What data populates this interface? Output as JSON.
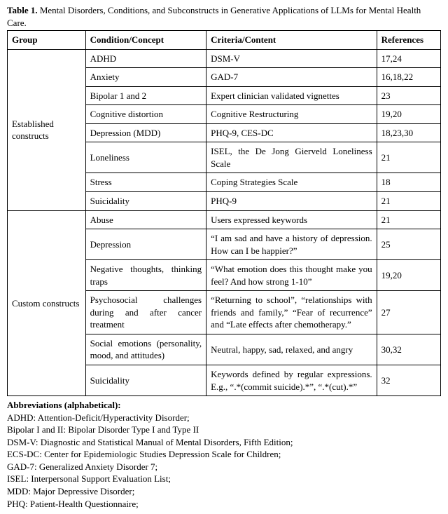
{
  "caption_prefix": "Table 1.",
  "caption_text": "Mental Disorders, Conditions, and Subconstructs in Generative Applications of LLMs for Mental Health Care.",
  "headers": {
    "group": "Group",
    "condition": "Condition/Concept",
    "criteria": "Criteria/Content",
    "refs": "References"
  },
  "groups": [
    {
      "label": "Established constructs",
      "rows": [
        {
          "condition": "ADHD",
          "criteria": "DSM-V",
          "refs": "17,24"
        },
        {
          "condition": "Anxiety",
          "criteria": "GAD-7",
          "refs": "16,18,22"
        },
        {
          "condition": "Bipolar 1 and 2",
          "criteria": "Expert clinician validated vignettes",
          "refs": "23"
        },
        {
          "condition": "Cognitive distortion",
          "criteria": "Cognitive Restructuring",
          "refs": "19,20"
        },
        {
          "condition": "Depression (MDD)",
          "criteria": "PHQ-9, CES-DC",
          "refs": "18,23,30"
        },
        {
          "condition": "Loneliness",
          "criteria": "ISEL, the De Jong Gierveld Loneliness Scale",
          "refs": "21"
        },
        {
          "condition": "Stress",
          "criteria": "Coping Strategies Scale",
          "refs": "18"
        },
        {
          "condition": "Suicidality",
          "criteria": "PHQ-9",
          "refs": "21"
        }
      ]
    },
    {
      "label": "Custom constructs",
      "rows": [
        {
          "condition": "Abuse",
          "criteria": "Users expressed keywords",
          "refs": "21"
        },
        {
          "condition": "Depression",
          "criteria": "“I am sad and have a history of depression. How can I be happier?”",
          "refs": "25"
        },
        {
          "condition": "Negative thoughts, thinking traps",
          "criteria": "“What emotion does this thought make you feel? And how strong 1-10”",
          "refs": "19,20"
        },
        {
          "condition": "Psychosocial challenges during and after cancer treatment",
          "criteria": "“Returning to school”, “relationships with friends and family,” “Fear of recurrence” and “Late effects after chemotherapy.”",
          "refs": "27"
        },
        {
          "condition": "Social emotions (personality, mood, and attitudes)",
          "criteria": "Neutral, happy, sad, relaxed, and angry",
          "refs": "30,32"
        },
        {
          "condition": "Suicidality",
          "criteria": "Keywords defined by regular expressions. E.g., “.*(commit suicide).*”, “.*(cut).*”",
          "refs": "32"
        }
      ]
    }
  ],
  "notes": {
    "title": "Abbreviations (alphabetical):",
    "lines": [
      "ADHD: Attention-Deficit/Hyperactivity Disorder;",
      "Bipolar I and II: Bipolar Disorder Type I and Type II",
      "DSM-V: Diagnostic and Statistical Manual of Mental Disorders, Fifth Edition;",
      "ECS-DC: Center for Epidemiologic Studies Depression Scale for Children;",
      "GAD-7: Generalized Anxiety Disorder 7;",
      "ISEL: Interpersonal Support Evaluation List;",
      "MDD: Major Depressive Disorder;",
      "PHQ: Patient-Health Questionnaire;"
    ]
  }
}
